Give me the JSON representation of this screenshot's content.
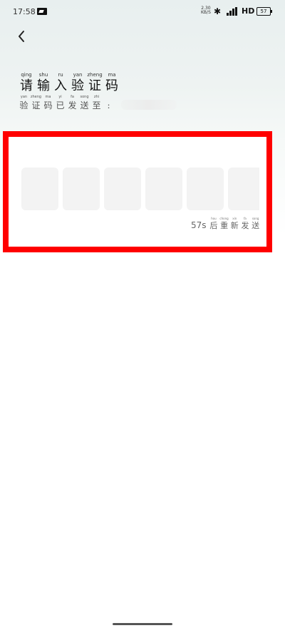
{
  "status_bar": {
    "time": "17:58",
    "speed_value": "2.30",
    "speed_unit": "KB/S",
    "network": "HD",
    "battery": "57"
  },
  "header": {
    "back_icon": "chevron-left-icon"
  },
  "title": {
    "chars": [
      {
        "pinyin": "qing",
        "hanzi": "请"
      },
      {
        "pinyin": "shu",
        "hanzi": "输"
      },
      {
        "pinyin": "ru",
        "hanzi": "入"
      },
      {
        "pinyin": "yan",
        "hanzi": "验"
      },
      {
        "pinyin": "zheng",
        "hanzi": "证"
      },
      {
        "pinyin": "ma",
        "hanzi": "码"
      }
    ]
  },
  "subtitle": {
    "chars": [
      {
        "pinyin": "yan",
        "hanzi": "验"
      },
      {
        "pinyin": "zheng",
        "hanzi": "证"
      },
      {
        "pinyin": "ma",
        "hanzi": "码"
      },
      {
        "pinyin": "yi",
        "hanzi": "已"
      },
      {
        "pinyin": "fa",
        "hanzi": "发"
      },
      {
        "pinyin": "song",
        "hanzi": "送"
      },
      {
        "pinyin": "zhi",
        "hanzi": "至"
      },
      {
        "pinyin": "",
        "hanzi": ":"
      }
    ]
  },
  "code_input": {
    "boxes": [
      "",
      "",
      "",
      "",
      "",
      ""
    ]
  },
  "resend": {
    "seconds": "57s",
    "chars": [
      {
        "pinyin": "hou",
        "hanzi": "后"
      },
      {
        "pinyin": "chong",
        "hanzi": "重"
      },
      {
        "pinyin": "xin",
        "hanzi": "新"
      },
      {
        "pinyin": "fa",
        "hanzi": "发"
      },
      {
        "pinyin": "song",
        "hanzi": "送"
      }
    ]
  },
  "colors": {
    "highlight": "#ff0000",
    "code_box_bg": "#f3f3f3"
  }
}
